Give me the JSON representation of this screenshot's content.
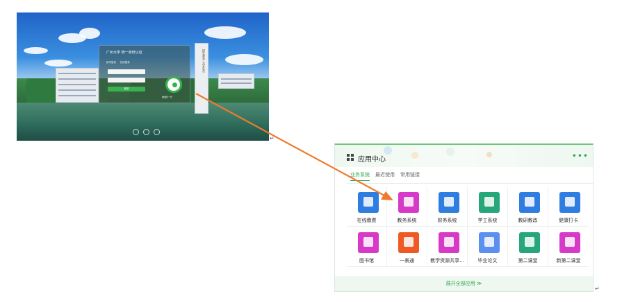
{
  "login_screenshot": {
    "system_title": "广州大学  统一身份认证",
    "login_tabs": [
      "帐号登录",
      "扫码登录"
    ],
    "login_button": "登录",
    "qr_note": "微信扫一扫",
    "tower_text": "招生就业 大学生活"
  },
  "app_center": {
    "title": "应用中心",
    "tabs": [
      "业务系统",
      "最近使用",
      "常用链接"
    ],
    "apps": [
      {
        "label": "在线缴费",
        "color": "#2f7de0"
      },
      {
        "label": "教务系统",
        "color": "#d63ac6"
      },
      {
        "label": "财务系统",
        "color": "#2f7de0"
      },
      {
        "label": "学工系统",
        "color": "#27a67a"
      },
      {
        "label": "教研教改",
        "color": "#2f7de0"
      },
      {
        "label": "健康打卡",
        "color": "#2f7de0"
      },
      {
        "label": "图书馆",
        "color": "#d63ac6"
      },
      {
        "label": "一表通",
        "color": "#ef5a24"
      },
      {
        "label": "教学资源共享...",
        "color": "#d63ac6"
      },
      {
        "label": "毕业论文",
        "color": "#5b8ff0"
      },
      {
        "label": "第二课堂",
        "color": "#27a67a"
      },
      {
        "label": "新第二课堂",
        "color": "#d63ac6"
      }
    ],
    "expand_label": "展开全部应用 ≫"
  },
  "accent_colors": {
    "arrow": "#ee7a2f",
    "green": "#2aa84a"
  }
}
